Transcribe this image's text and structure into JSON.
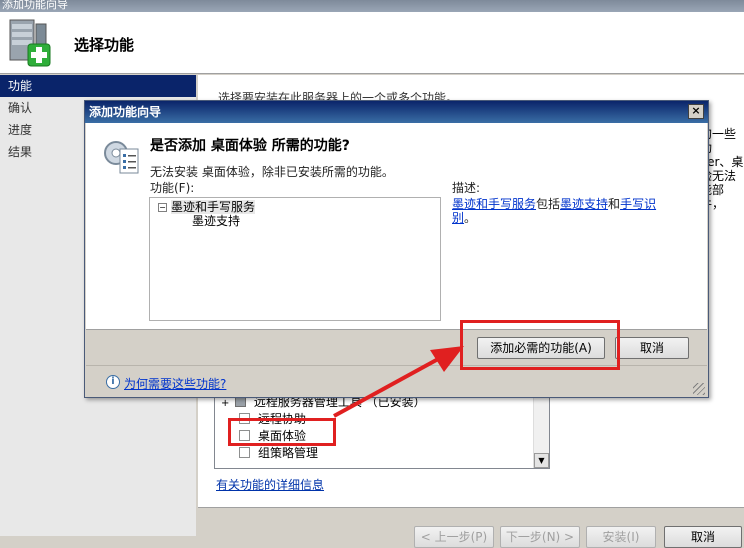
{
  "outer_window": {
    "title": "添加功能向导",
    "header_title": "选择功能",
    "nav": [
      "功能",
      "确认",
      "进度",
      "结果"
    ],
    "intro_text": "选择要安装在此服务器上的一个或多个功能。",
    "right_fragment": [
      "的一些功",
      "yer、桌",
      "验无法",
      "能部件，"
    ],
    "feature_rows": [
      {
        "label": "远程服务器管理工具 （已安装）",
        "state": "partial",
        "expand": "+"
      },
      {
        "label": "远程协助",
        "state": "unchecked"
      },
      {
        "label": "桌面体验",
        "state": "unchecked"
      },
      {
        "label": "组策略管理",
        "state": "unchecked"
      }
    ],
    "more_link": "有关功能的详细信息",
    "buttons": {
      "prev": "< 上一步(P)",
      "next": "下一步(N) >",
      "install": "安装(I)",
      "cancel": "取消"
    }
  },
  "dialog": {
    "title": "添加功能向导",
    "close": "×",
    "heading": "是否添加 桌面体验 所需的功能?",
    "subtext": "无法安装 桌面体验，除非已安装所需的功能。",
    "features_label": "功能(F):",
    "tree": [
      {
        "label": "墨迹和手写服务",
        "toggle": "−"
      },
      {
        "label": "墨迹支持"
      }
    ],
    "desc_label": "描述:",
    "desc": {
      "link1": "墨迹和手写服务",
      "t1": "包括",
      "link2": "墨迹支持",
      "t2": "和",
      "link3": "手写识别",
      "t3": "。"
    },
    "add_button": "添加必需的功能(A)",
    "cancel_button": "取消",
    "why_link": "为何需要这些功能?"
  },
  "annotation_color": "#e02020"
}
